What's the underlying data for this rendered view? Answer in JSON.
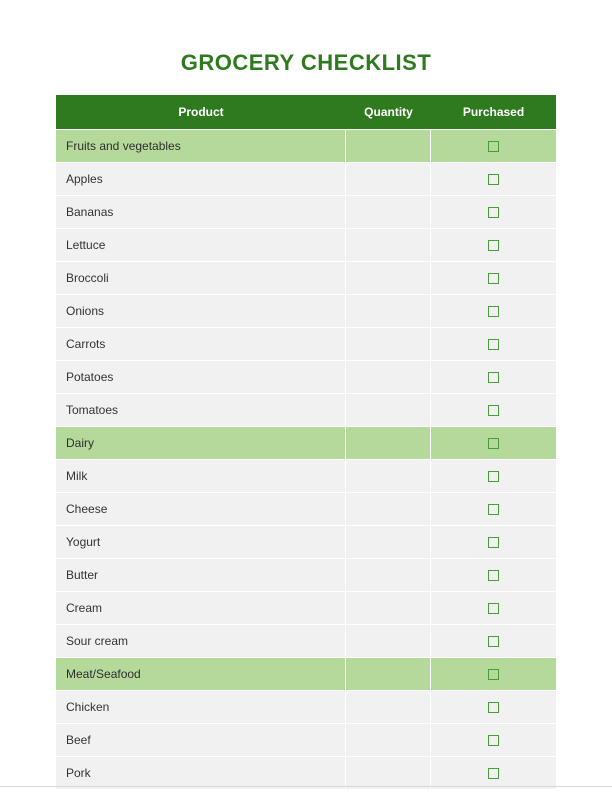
{
  "title": "GROCERY CHECKLIST",
  "columns": {
    "product": "Product",
    "quantity": "Quantity",
    "purchased": "Purchased"
  },
  "rows": [
    {
      "label": "Fruits and vegetables",
      "quantity": "",
      "category": true
    },
    {
      "label": "Apples",
      "quantity": "",
      "category": false
    },
    {
      "label": "Bananas",
      "quantity": "",
      "category": false
    },
    {
      "label": "Lettuce",
      "quantity": "",
      "category": false
    },
    {
      "label": "Broccoli",
      "quantity": "",
      "category": false
    },
    {
      "label": "Onions",
      "quantity": "",
      "category": false
    },
    {
      "label": "Carrots",
      "quantity": "",
      "category": false
    },
    {
      "label": "Potatoes",
      "quantity": "",
      "category": false
    },
    {
      "label": "Tomatoes",
      "quantity": "",
      "category": false
    },
    {
      "label": "Dairy",
      "quantity": "",
      "category": true
    },
    {
      "label": "Milk",
      "quantity": "",
      "category": false
    },
    {
      "label": "Cheese",
      "quantity": "",
      "category": false
    },
    {
      "label": "Yogurt",
      "quantity": "",
      "category": false
    },
    {
      "label": "Butter",
      "quantity": "",
      "category": false
    },
    {
      "label": "Cream",
      "quantity": "",
      "category": false
    },
    {
      "label": "Sour cream",
      "quantity": "",
      "category": false
    },
    {
      "label": "Meat/Seafood",
      "quantity": "",
      "category": true
    },
    {
      "label": "Chicken",
      "quantity": "",
      "category": false
    },
    {
      "label": "Beef",
      "quantity": "",
      "category": false
    },
    {
      "label": "Pork",
      "quantity": "",
      "category": false
    }
  ]
}
